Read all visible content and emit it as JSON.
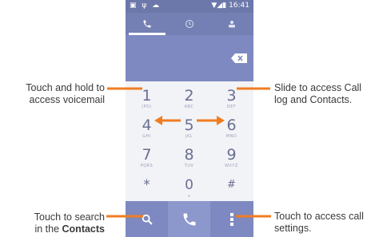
{
  "statusbar": {
    "left_icons": "▣ ψ ☁",
    "right": "▼◢▮ 16:41"
  },
  "tabs": [
    {
      "name": "dialer",
      "icon": "phone-icon"
    },
    {
      "name": "call-log",
      "icon": "clock-icon"
    },
    {
      "name": "contacts",
      "icon": "person-icon"
    }
  ],
  "keys": [
    {
      "digit": "1",
      "letters": "(PD)"
    },
    {
      "digit": "2",
      "letters": "ABC"
    },
    {
      "digit": "3",
      "letters": "DEF"
    },
    {
      "digit": "4",
      "letters": "GHI"
    },
    {
      "digit": "5",
      "letters": "JKL"
    },
    {
      "digit": "6",
      "letters": "MNO"
    },
    {
      "digit": "7",
      "letters": "PQRS"
    },
    {
      "digit": "8",
      "letters": "TUV"
    },
    {
      "digit": "9",
      "letters": "WXYZ"
    },
    {
      "digit": "*",
      "letters": ""
    },
    {
      "digit": "0",
      "letters": "+"
    },
    {
      "digit": "#",
      "letters": ""
    }
  ],
  "callouts": {
    "voicemail_line1": "Touch and hold to",
    "voicemail_line2": "access voicemail",
    "slide_line1": "Slide to access Call",
    "slide_line2": "log and Contacts.",
    "search_line1": "Touch to search",
    "search_line2_prefix": "in the ",
    "search_line2_bold": "Contacts",
    "settings_line1": "Touch to access call",
    "settings_line2": "settings."
  },
  "colors": {
    "accent_orange": "#ef7d22",
    "statusbar": "#6d78aa",
    "display": "#7d89c0"
  }
}
